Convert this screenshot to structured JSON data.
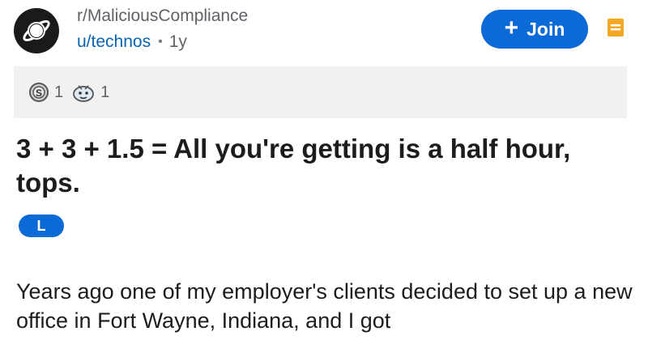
{
  "post": {
    "subreddit": "r/MaliciousCompliance",
    "author": "u/technos",
    "separator": "•",
    "age": "1y",
    "join_label": "Join",
    "join_icon": "plus-icon",
    "save_icon": "bookmark-icon",
    "awards": [
      {
        "icon": "silver-award-icon",
        "count": "1"
      },
      {
        "icon": "wholesome-award-icon",
        "count": "1"
      }
    ],
    "title": "3 + 3 + 1.5 = All you're getting is a half hour, tops.",
    "flair": "L",
    "body": "Years ago one of my employer's clients decided to set up a new office in Fort Wayne, Indiana, and I got"
  },
  "colors": {
    "accent": "#0c6ad6",
    "username": "#0a63b0",
    "save_icon": "#f5a623"
  }
}
